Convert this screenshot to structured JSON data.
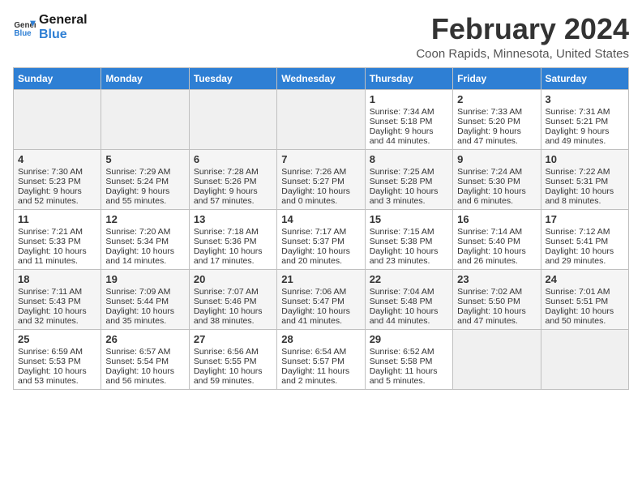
{
  "app": {
    "name_line1": "General",
    "name_line2": "Blue"
  },
  "header": {
    "title": "February 2024",
    "subtitle": "Coon Rapids, Minnesota, United States"
  },
  "days_of_week": [
    "Sunday",
    "Monday",
    "Tuesday",
    "Wednesday",
    "Thursday",
    "Friday",
    "Saturday"
  ],
  "weeks": [
    [
      {
        "day": null
      },
      {
        "day": null
      },
      {
        "day": null
      },
      {
        "day": null
      },
      {
        "day": 1,
        "sunrise": "7:34 AM",
        "sunset": "5:18 PM",
        "daylight": "9 hours and 44 minutes."
      },
      {
        "day": 2,
        "sunrise": "7:33 AM",
        "sunset": "5:20 PM",
        "daylight": "9 hours and 47 minutes."
      },
      {
        "day": 3,
        "sunrise": "7:31 AM",
        "sunset": "5:21 PM",
        "daylight": "9 hours and 49 minutes."
      }
    ],
    [
      {
        "day": 4,
        "sunrise": "7:30 AM",
        "sunset": "5:23 PM",
        "daylight": "9 hours and 52 minutes."
      },
      {
        "day": 5,
        "sunrise": "7:29 AM",
        "sunset": "5:24 PM",
        "daylight": "9 hours and 55 minutes."
      },
      {
        "day": 6,
        "sunrise": "7:28 AM",
        "sunset": "5:26 PM",
        "daylight": "9 hours and 57 minutes."
      },
      {
        "day": 7,
        "sunrise": "7:26 AM",
        "sunset": "5:27 PM",
        "daylight": "10 hours and 0 minutes."
      },
      {
        "day": 8,
        "sunrise": "7:25 AM",
        "sunset": "5:28 PM",
        "daylight": "10 hours and 3 minutes."
      },
      {
        "day": 9,
        "sunrise": "7:24 AM",
        "sunset": "5:30 PM",
        "daylight": "10 hours and 6 minutes."
      },
      {
        "day": 10,
        "sunrise": "7:22 AM",
        "sunset": "5:31 PM",
        "daylight": "10 hours and 8 minutes."
      }
    ],
    [
      {
        "day": 11,
        "sunrise": "7:21 AM",
        "sunset": "5:33 PM",
        "daylight": "10 hours and 11 minutes."
      },
      {
        "day": 12,
        "sunrise": "7:20 AM",
        "sunset": "5:34 PM",
        "daylight": "10 hours and 14 minutes."
      },
      {
        "day": 13,
        "sunrise": "7:18 AM",
        "sunset": "5:36 PM",
        "daylight": "10 hours and 17 minutes."
      },
      {
        "day": 14,
        "sunrise": "7:17 AM",
        "sunset": "5:37 PM",
        "daylight": "10 hours and 20 minutes."
      },
      {
        "day": 15,
        "sunrise": "7:15 AM",
        "sunset": "5:38 PM",
        "daylight": "10 hours and 23 minutes."
      },
      {
        "day": 16,
        "sunrise": "7:14 AM",
        "sunset": "5:40 PM",
        "daylight": "10 hours and 26 minutes."
      },
      {
        "day": 17,
        "sunrise": "7:12 AM",
        "sunset": "5:41 PM",
        "daylight": "10 hours and 29 minutes."
      }
    ],
    [
      {
        "day": 18,
        "sunrise": "7:11 AM",
        "sunset": "5:43 PM",
        "daylight": "10 hours and 32 minutes."
      },
      {
        "day": 19,
        "sunrise": "7:09 AM",
        "sunset": "5:44 PM",
        "daylight": "10 hours and 35 minutes."
      },
      {
        "day": 20,
        "sunrise": "7:07 AM",
        "sunset": "5:46 PM",
        "daylight": "10 hours and 38 minutes."
      },
      {
        "day": 21,
        "sunrise": "7:06 AM",
        "sunset": "5:47 PM",
        "daylight": "10 hours and 41 minutes."
      },
      {
        "day": 22,
        "sunrise": "7:04 AM",
        "sunset": "5:48 PM",
        "daylight": "10 hours and 44 minutes."
      },
      {
        "day": 23,
        "sunrise": "7:02 AM",
        "sunset": "5:50 PM",
        "daylight": "10 hours and 47 minutes."
      },
      {
        "day": 24,
        "sunrise": "7:01 AM",
        "sunset": "5:51 PM",
        "daylight": "10 hours and 50 minutes."
      }
    ],
    [
      {
        "day": 25,
        "sunrise": "6:59 AM",
        "sunset": "5:53 PM",
        "daylight": "10 hours and 53 minutes."
      },
      {
        "day": 26,
        "sunrise": "6:57 AM",
        "sunset": "5:54 PM",
        "daylight": "10 hours and 56 minutes."
      },
      {
        "day": 27,
        "sunrise": "6:56 AM",
        "sunset": "5:55 PM",
        "daylight": "10 hours and 59 minutes."
      },
      {
        "day": 28,
        "sunrise": "6:54 AM",
        "sunset": "5:57 PM",
        "daylight": "11 hours and 2 minutes."
      },
      {
        "day": 29,
        "sunrise": "6:52 AM",
        "sunset": "5:58 PM",
        "daylight": "11 hours and 5 minutes."
      },
      {
        "day": null
      },
      {
        "day": null
      }
    ]
  ],
  "labels": {
    "sunrise": "Sunrise:",
    "sunset": "Sunset:",
    "daylight": "Daylight:"
  }
}
